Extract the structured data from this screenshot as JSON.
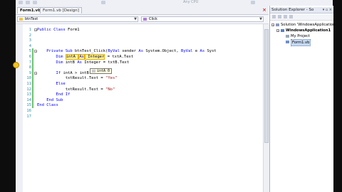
{
  "toolbar": {
    "status_text": "Any CPU"
  },
  "tabs": [
    {
      "label": "Form1.vb",
      "active": true
    },
    {
      "label": "Form1.vb [Design]",
      "active": false
    }
  ],
  "close_glyph": "×",
  "nav": {
    "object_combo": "btnTest",
    "method_combo": "Click"
  },
  "editor": {
    "lines": [
      {
        "n": "1",
        "segs": [
          [
            "kw",
            "Public Class "
          ],
          [
            "",
            "Form1"
          ]
        ]
      },
      {
        "n": "2",
        "segs": []
      },
      {
        "n": "3",
        "segs": []
      },
      {
        "n": "4",
        "segs": []
      },
      {
        "n": "5",
        "segs": [
          [
            "kw",
            "    Private Sub "
          ],
          [
            "",
            "btnTest_Click("
          ],
          [
            "kw",
            "ByVal"
          ],
          [
            "",
            " sender "
          ],
          [
            "kw",
            "As"
          ],
          [
            "",
            " System.Object, "
          ],
          [
            "kw",
            "ByVal"
          ],
          [
            "",
            " e "
          ],
          [
            "kw",
            "As"
          ],
          [
            "",
            " Syst"
          ]
        ]
      },
      {
        "n": "6",
        "segs": [
          [
            "kw",
            "        Dim "
          ],
          [
            "hl",
            "intA "
          ],
          [
            "hl-kw",
            "As"
          ],
          [
            "hl",
            " Integer"
          ],
          [
            "",
            " = txtA.Text"
          ]
        ]
      },
      {
        "n": "7",
        "segs": [
          [
            "kw",
            "        Dim "
          ],
          [
            "",
            "intB "
          ],
          [
            "kw",
            "As"
          ],
          [
            "",
            " Integer = txtB.Text"
          ]
        ]
      },
      {
        "n": "8",
        "segs": []
      },
      {
        "n": "9",
        "segs": [
          [
            "kw",
            "        If "
          ],
          [
            "",
            "intA > intB "
          ],
          [
            "kw",
            "Then"
          ]
        ]
      },
      {
        "n": "10",
        "segs": [
          [
            "",
            "            txtResult.Text = "
          ],
          [
            "str",
            "\"Yes\""
          ]
        ]
      },
      {
        "n": "11",
        "segs": [
          [
            "kw",
            "        Else"
          ]
        ]
      },
      {
        "n": "12",
        "segs": [
          [
            "",
            "            txtResult.Text = "
          ],
          [
            "str",
            "\"No\""
          ]
        ]
      },
      {
        "n": "13",
        "segs": [
          [
            "kw",
            "        End If"
          ]
        ]
      },
      {
        "n": "14",
        "segs": [
          [
            "kw",
            "    End Sub"
          ]
        ]
      },
      {
        "n": "15",
        "segs": [
          [
            "kw",
            "End Class"
          ]
        ]
      },
      {
        "n": "16",
        "segs": []
      },
      {
        "n": "17",
        "segs": []
      }
    ],
    "tooltip": "intA 0"
  },
  "solution_explorer": {
    "title": "Solution Explorer - So",
    "items": [
      {
        "label": "Solution 'WindowsApplication",
        "level": 0,
        "icon": "solution-icon",
        "bold": false
      },
      {
        "label": "WindowsApplication1",
        "level": 1,
        "icon": "project-icon",
        "bold": true
      },
      {
        "label": "My Project",
        "level": 2,
        "icon": "my-project-icon",
        "bold": false
      },
      {
        "label": "Form1.vb",
        "level": 2,
        "icon": "form-file-icon",
        "bold": false,
        "selected": true
      }
    ]
  },
  "colors": {
    "keyword": "#0000ff",
    "string": "#a31515",
    "line_number": "#2b91af",
    "highlight": "#fff3a8"
  }
}
